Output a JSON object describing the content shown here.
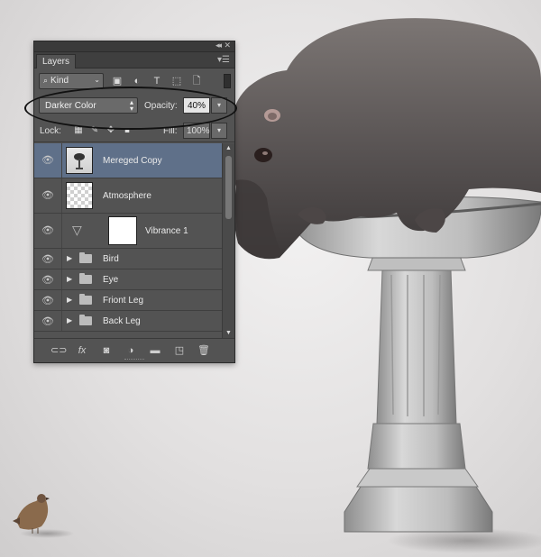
{
  "panel": {
    "title": "Layers",
    "collapse_icon": "double-chevron-icon",
    "close_icon": "close-icon",
    "menu_icon": "panel-menu-icon"
  },
  "filter": {
    "kind_label": "Kind",
    "icons": [
      "image-filter-icon",
      "adjustment-filter-icon",
      "type-filter-icon",
      "shape-filter-icon",
      "smart-object-filter-icon"
    ]
  },
  "blend": {
    "mode": "Darker Color",
    "opacity_label": "Opacity:",
    "opacity_value": "40%"
  },
  "lock": {
    "label": "Lock:",
    "fill_label": "Fill:",
    "fill_value": "100%",
    "icons": [
      "lock-transparent-icon",
      "lock-brush-icon",
      "lock-position-icon",
      "lock-all-icon"
    ]
  },
  "layers": [
    {
      "name": "Mereged Copy",
      "type": "pixel",
      "selected": true
    },
    {
      "name": "Atmosphere",
      "type": "pixel",
      "selected": false
    },
    {
      "name": "Vibrance 1",
      "type": "adjustment",
      "selected": false
    },
    {
      "name": "Bird",
      "type": "group",
      "selected": false
    },
    {
      "name": "Eye",
      "type": "group",
      "selected": false
    },
    {
      "name": "Friont Leg",
      "type": "group",
      "selected": false
    },
    {
      "name": "Back Leg",
      "type": "group",
      "selected": false
    }
  ],
  "bottom_bar_icons": [
    "link-icon",
    "fx-icon",
    "mask-icon",
    "adjustment-layer-icon",
    "new-group-icon",
    "new-layer-icon",
    "trash-icon"
  ],
  "colors": {
    "panel_bg": "#535353",
    "selected_layer": "#5f7089",
    "canvas_bg": "#e2e0e0"
  }
}
